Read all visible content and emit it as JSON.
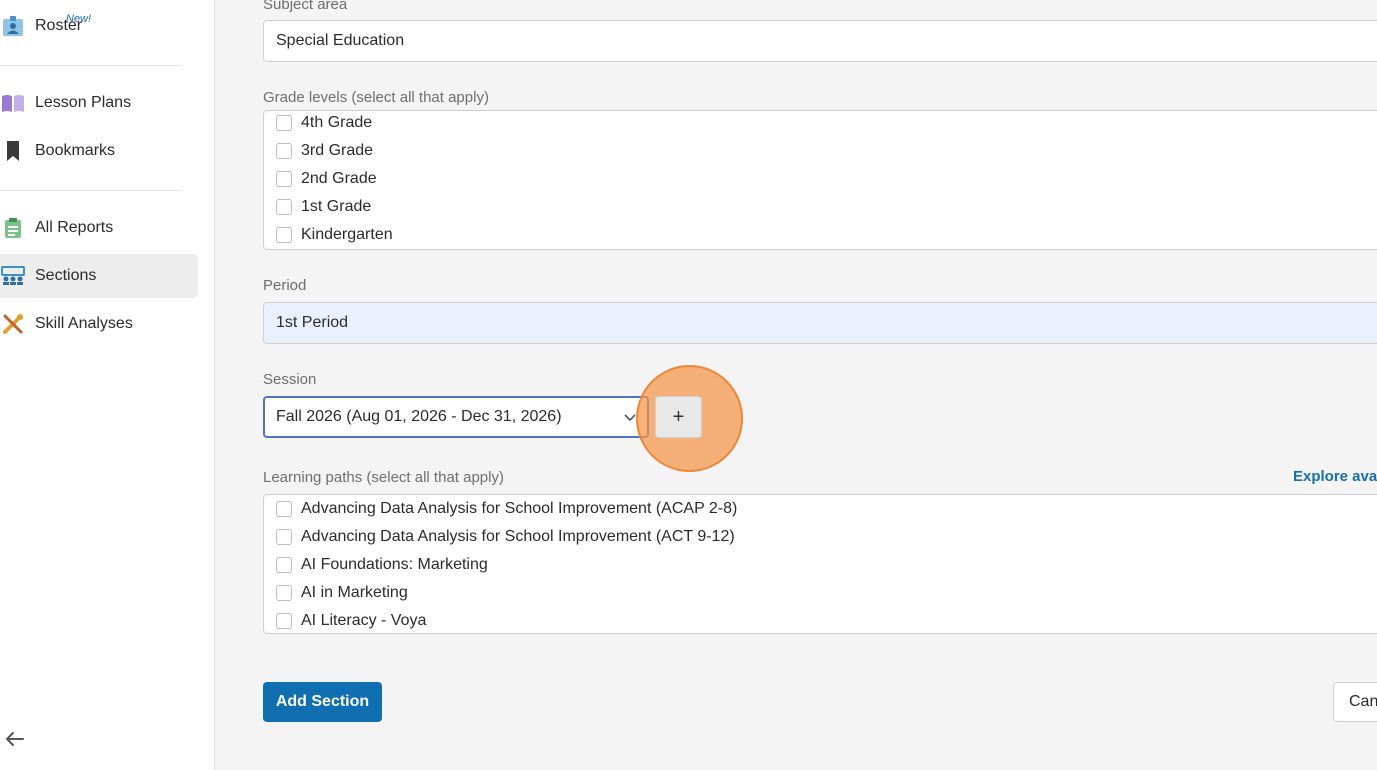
{
  "sidebar": {
    "roster": {
      "label": "Roster",
      "badge": "New!",
      "icon": "roster-icon"
    },
    "lesson_plans": {
      "label": "Lesson Plans",
      "icon": "book-icon"
    },
    "bookmarks": {
      "label": "Bookmarks",
      "icon": "bookmark-icon"
    },
    "all_reports": {
      "label": "All Reports",
      "icon": "clipboard-icon"
    },
    "sections": {
      "label": "Sections",
      "icon": "classroom-icon"
    },
    "skill_analyses": {
      "label": "Skill Analyses",
      "icon": "tools-icon"
    },
    "back": {
      "icon": "arrow-left-icon"
    }
  },
  "form": {
    "subject_area": {
      "label": "Subject area",
      "value": "Special Education"
    },
    "grade_levels": {
      "label": "Grade levels (select all that apply)",
      "options": [
        "4th Grade",
        "3rd Grade",
        "2nd Grade",
        "1st Grade",
        "Kindergarten"
      ]
    },
    "period": {
      "label": "Period",
      "value": "1st Period"
    },
    "session": {
      "label": "Session",
      "value": "Fall 2026 (Aug 01, 2026 - Dec 31, 2026)",
      "add_label": "+"
    },
    "learning_paths": {
      "label": "Learning paths (select all that apply)",
      "explore_link": "Explore avai",
      "options": [
        "Advancing Data Analysis for School Improvement (ACAP 2-8)",
        "Advancing Data Analysis for School Improvement (ACT 9-12)",
        "AI Foundations: Marketing",
        "AI in Marketing",
        "AI Literacy - Voya"
      ]
    },
    "add_button": "Add Section",
    "cancel_button": "Can"
  },
  "colors": {
    "primary": "#0f6fb0",
    "link": "#1670a8",
    "highlight": "#f59646",
    "focus": "#4e72c4"
  }
}
